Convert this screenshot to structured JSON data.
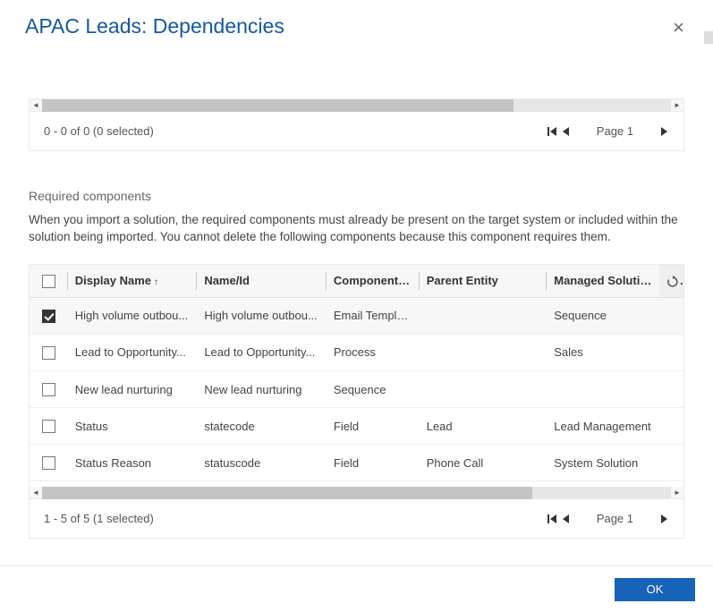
{
  "header": {
    "title": "APAC Leads: Dependencies"
  },
  "upper": {
    "pager_text": "0 - 0 of 0 (0 selected)",
    "page_label": "Page 1"
  },
  "section": {
    "heading": "Required components",
    "description": "When you import a solution, the required components must already be present on the target system or included within the solution being imported. You cannot delete the following components because this component requires them."
  },
  "table": {
    "headers": {
      "display_name": "Display Name",
      "name_id": "Name/Id",
      "component_type": "Component T...",
      "parent_entity": "Parent Entity",
      "managed_solution": "Managed Solution"
    },
    "rows": [
      {
        "checked": true,
        "display_name": "High volume outbou...",
        "name_id": "High volume outbou...",
        "component_type": "Email Template",
        "parent_entity": "",
        "managed_solution": "Sequence"
      },
      {
        "checked": false,
        "display_name": "Lead to Opportunity...",
        "name_id": "Lead to Opportunity...",
        "component_type": "Process",
        "parent_entity": "",
        "managed_solution": "Sales"
      },
      {
        "checked": false,
        "display_name": "New lead nurturing",
        "name_id": "New lead nurturing",
        "component_type": "Sequence",
        "parent_entity": "",
        "managed_solution": ""
      },
      {
        "checked": false,
        "display_name": "Status",
        "name_id": "statecode",
        "component_type": "Field",
        "parent_entity": "Lead",
        "managed_solution": "Lead Management"
      },
      {
        "checked": false,
        "display_name": "Status Reason",
        "name_id": "statuscode",
        "component_type": "Field",
        "parent_entity": "Phone Call",
        "managed_solution": "System Solution"
      }
    ]
  },
  "lower": {
    "pager_text": "1 - 5 of 5 (1 selected)",
    "page_label": "Page 1"
  },
  "footer": {
    "ok_label": "OK"
  }
}
